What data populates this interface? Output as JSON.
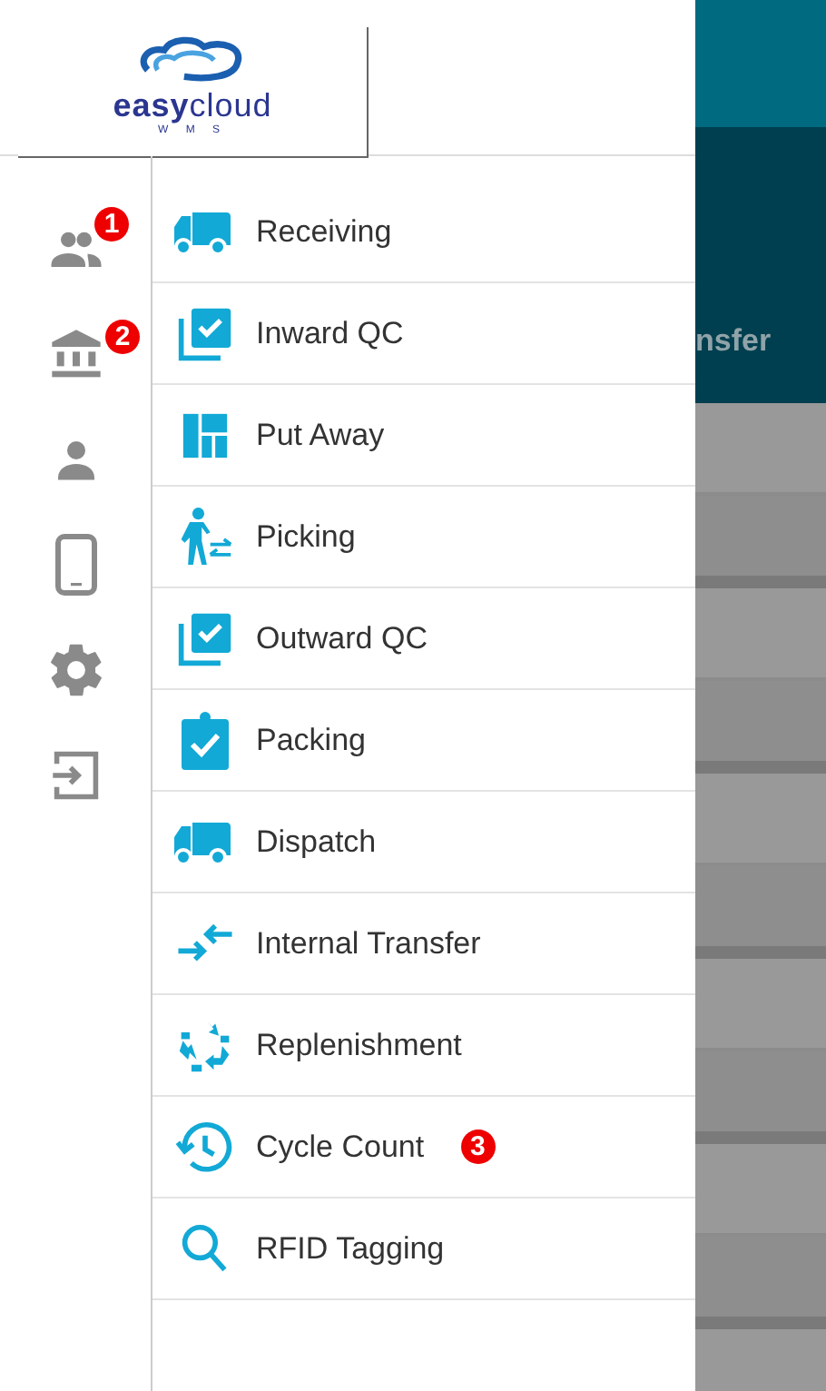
{
  "logo": {
    "word_1": "easy",
    "word_2": "cloud",
    "subtitle": "W M S"
  },
  "rail_badges": [
    "1",
    "2"
  ],
  "menu": [
    {
      "label": "Receiving"
    },
    {
      "label": "Inward QC"
    },
    {
      "label": "Put Away"
    },
    {
      "label": "Picking"
    },
    {
      "label": "Outward QC"
    },
    {
      "label": "Packing"
    },
    {
      "label": "Dispatch"
    },
    {
      "label": "Internal Transfer"
    },
    {
      "label": "Replenishment"
    },
    {
      "label": "Cycle Count",
      "badge": "3"
    },
    {
      "label": "RFID Tagging"
    }
  ],
  "background": {
    "tab_text": "nsfer"
  }
}
